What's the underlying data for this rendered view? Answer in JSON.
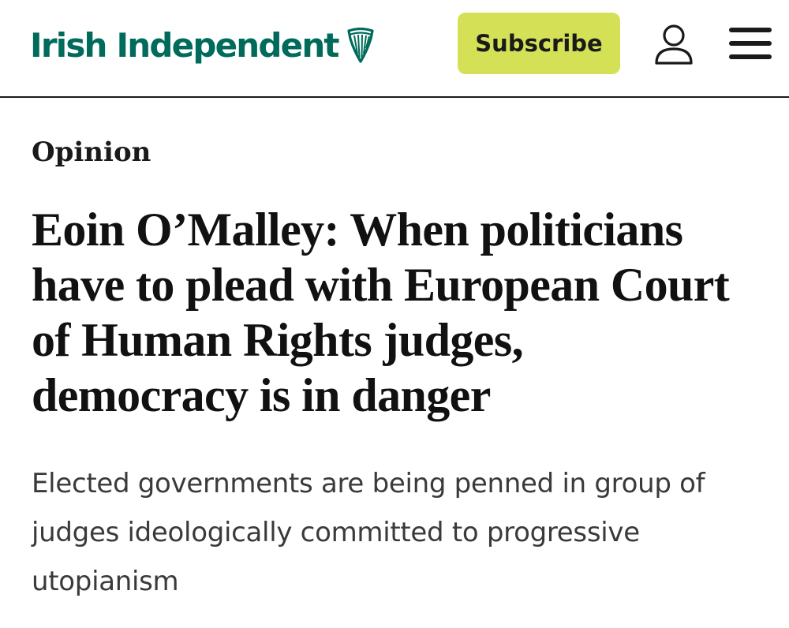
{
  "header": {
    "logo_text": "Irish Independent",
    "logo_icon": "harp-icon",
    "subscribe_label": "Subscribe",
    "account_icon": "user-icon",
    "menu_icon": "hamburger-menu-icon",
    "colors": {
      "brand": "#006b5b",
      "subscribe_bg": "#d4e157"
    }
  },
  "article": {
    "section": "Opinion",
    "headline_lines": [
      "Eoin O’Malley: When politicians",
      "have to plead with European Court",
      "of Human Rights judges,",
      "democracy is in danger"
    ],
    "standfirst_lines": [
      "Elected governments are being penned in group of",
      "judges ideologically committed to progressive",
      "utopianism"
    ]
  }
}
